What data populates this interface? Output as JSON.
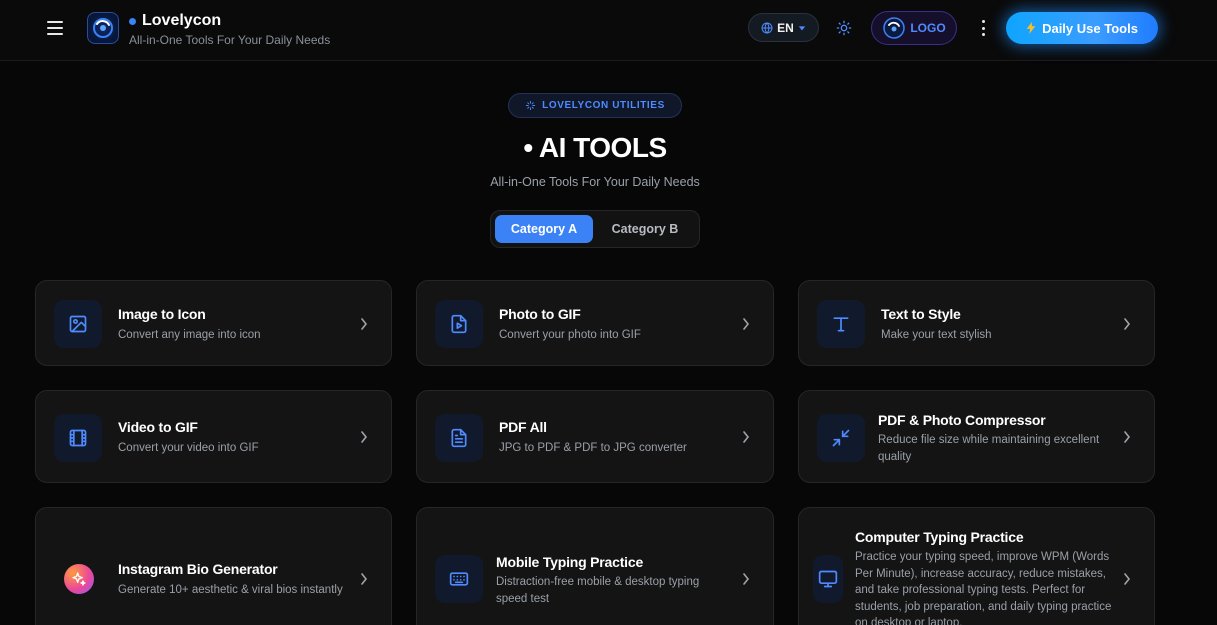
{
  "header": {
    "brand_name": "Lovelycon",
    "brand_tagline": "All-in-One Tools For Your Daily Needs",
    "language": "EN",
    "logo_button_label": "LOGO",
    "daily_button_label": "Daily Use Tools"
  },
  "hero": {
    "badge": "LOVELYCON UTILITIES",
    "title": "• AI TOOLS",
    "subtitle": "All-in-One Tools For Your Daily Needs",
    "categories": [
      "Category A",
      "Category B"
    ]
  },
  "cards": [
    {
      "title": "Image to Icon",
      "desc": "Convert any image into icon",
      "icon": "image-icon"
    },
    {
      "title": "Photo to GIF",
      "desc": "Convert your photo into GIF",
      "icon": "file-video-icon"
    },
    {
      "title": "Text to Style",
      "desc": "Make your text stylish",
      "icon": "type-icon"
    },
    {
      "title": "Video to GIF",
      "desc": "Convert your video into GIF",
      "icon": "film-icon"
    },
    {
      "title": "PDF All",
      "desc": "JPG to PDF & PDF to JPG converter",
      "icon": "file-text-icon"
    },
    {
      "title": "PDF & Photo Compressor",
      "desc": "Reduce file size while maintaining excellent quality",
      "icon": "minimize-icon"
    },
    {
      "title": "Instagram Bio Generator",
      "desc": "Generate 10+ aesthetic & viral bios instantly",
      "icon": "sparkles-icon"
    },
    {
      "title": "Mobile Typing Practice",
      "desc": "Distraction-free mobile & desktop typing speed test",
      "icon": "keyboard-icon"
    },
    {
      "title": "Computer Typing Practice",
      "desc": "Practice your typing speed, improve WPM (Words Per Minute), increase accuracy, reduce mistakes, and take professional typing tests. Perfect for students, job preparation, and daily typing practice on desktop or laptop.",
      "icon": "monitor-icon"
    }
  ],
  "colors": {
    "accent": "#3b82f6",
    "background": "#070707",
    "card": "#141414"
  }
}
